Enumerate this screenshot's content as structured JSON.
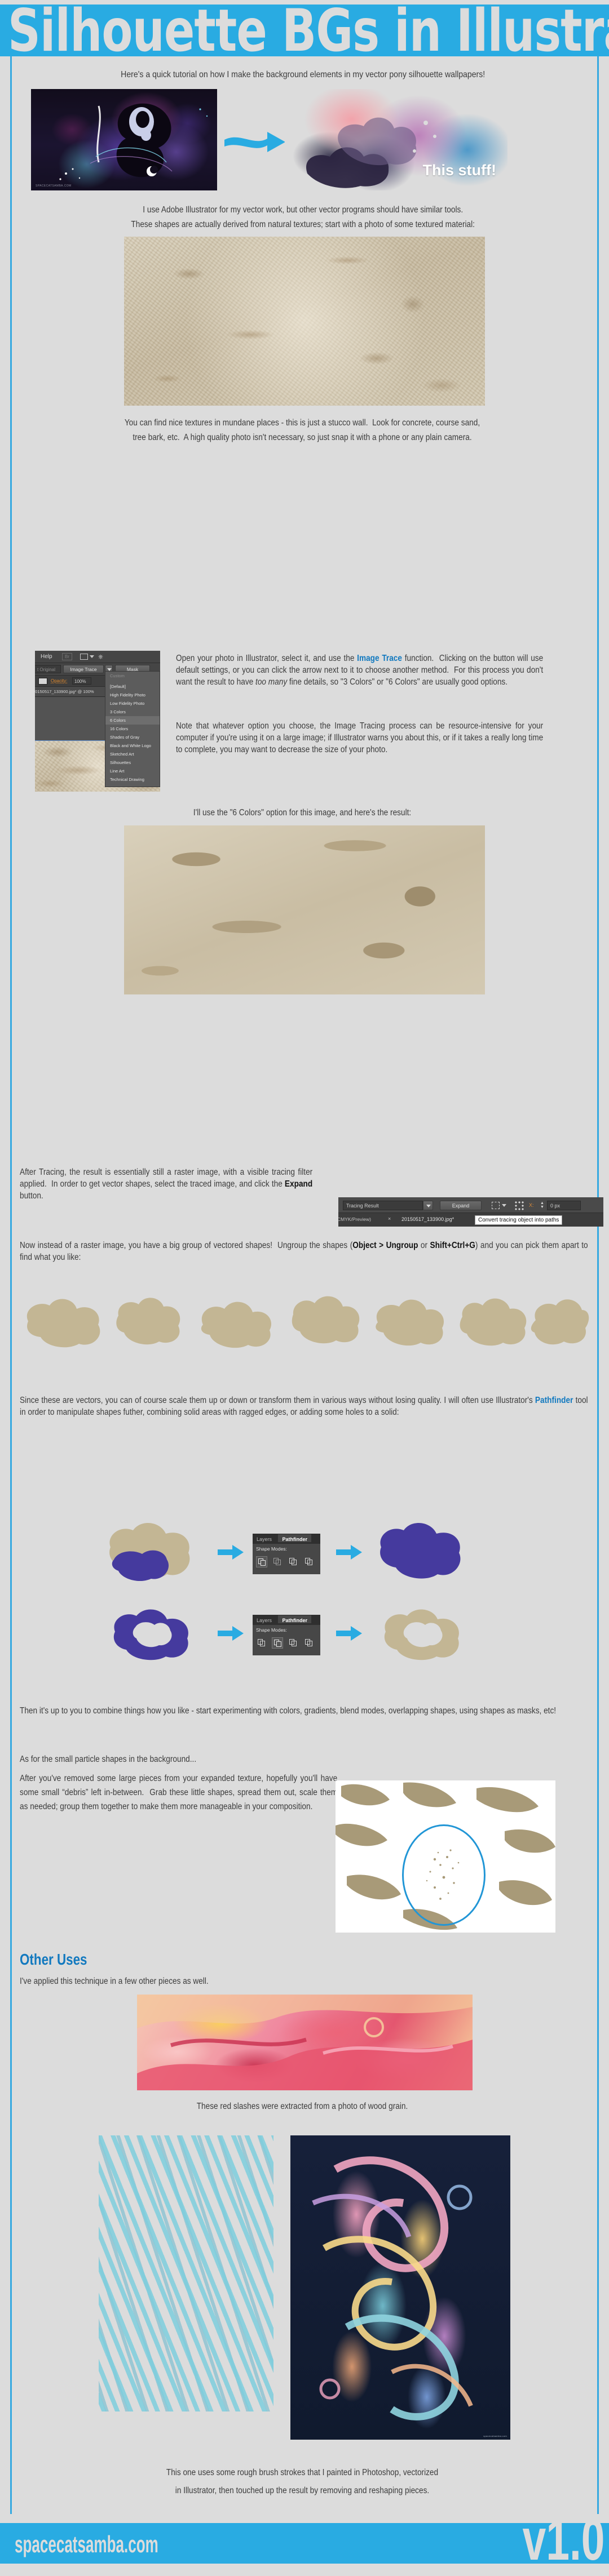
{
  "header": {
    "title": "Silhouette BGs in Illustrator",
    "accent_color": "#29abe2",
    "bg_color": "#dcdcdc"
  },
  "footer": {
    "site": "spacecatsamba.com",
    "version": "v1.0"
  },
  "intro": {
    "line": "Here's a quick tutorial on how I make the background elements in my vector pony silhouette wallpapers!",
    "callout_label": "This stuff!"
  },
  "section_tools": {
    "line1": "I use Adobe Illustrator for my vector work, but other vector programs should have similar tools.",
    "line2": "These shapes are actually derived from natural textures; start with a photo of some textured material:"
  },
  "section_texture": {
    "line1": "You can find nice textures in mundane places - this is just a stucco wall.  Look for concrete, course sand,",
    "line2": "tree bark, etc.  A high quality photo isn't necessary, so just snap it with a phone or any plain camera."
  },
  "section_trace": {
    "p1_a": "Open your photo in Illustrator, select it, and use the ",
    "p1_accent": "Image Trace",
    "p1_b": " function.  Clicking on the button will use default settings, or you can click the arrow next to it to choose another method.  For this process you don't want the result to have ",
    "p1_ital": "too many",
    "p1_c": " fine details, so \"3 Colors\" or \"6 Colors\" are usually good options.",
    "p2": "Note that whatever option you choose, the Image Tracing process can be resource-intensive for your computer if you're using it on a large image; if Illustrator warns you about this, or if it takes a really long time to complete, you may want to decrease the size of your photo.",
    "result_line": "I'll use the \"6 Colors\" option for this image, and here's the result:"
  },
  "illustrator_panel": {
    "menu_help": "Help",
    "btn_bridge": "Br",
    "btn_original": "t Original",
    "btn_image_trace": "Image Trace",
    "btn_mask": "Mask",
    "doc_title": "20150517_133900.jpg* @ 100%",
    "opacity_label": "Opacity:",
    "opacity_value": "100%",
    "dropdown_items": [
      "Custom",
      "[Default]",
      "High Fidelity Photo",
      "Low Fidelity Photo",
      "3 Colors",
      "6 Colors",
      "16 Colors",
      "Shades of Gray",
      "Black and White Logo",
      "Sketched Art",
      "Silhouettes",
      "Line Art",
      "Technical Drawing"
    ],
    "selected_item": "6 Colors",
    "dim_item": "Custom"
  },
  "section_expand": {
    "p1_a": "After Tracing, the result is essentially still a raster image, with a visible tracing filter applied.  In order to get vector shapes, select the traced image, and click the ",
    "p1_bold": "Expand",
    "p1_b": " button.",
    "toolbar": {
      "preset": "Tracing Result",
      "expand_btn": "Expand",
      "px_value": "0 px",
      "tab_left": "CMYK/Preview)",
      "tab_close": "×",
      "tab_doc": "20150517_133900.jpg*",
      "tooltip": "Convert tracing object into paths"
    }
  },
  "section_ungroup": {
    "a": "Now instead of a raster image, you have a big group of vectored shapes!  Ungroup the shapes (",
    "bold1": "Object > Ungroup",
    "b": " or ",
    "bold2": "Shift+Ctrl+G",
    "c": ") and you can pick them apart to find what you like:"
  },
  "section_pathfinder": {
    "a": "Since these are vectors, you can of course scale them up or down or transform them in various ways without losing quality. I will often use Illustrator's ",
    "accent": "Pathfinder",
    "b": " tool in order to manipulate shapes futher, combining solid areas with ragged edges, or adding some holes to a solid:",
    "panel": {
      "tab_layers": "Layers",
      "tab_pathfinder": "Pathfinder",
      "shape_modes_label": "Shape Modes:"
    }
  },
  "section_combine": {
    "p1": "Then it's up to you to combine things how you like - start experimenting with colors, gradients, blend modes, overlapping shapes, using shapes as masks, etc!",
    "p2_head": "As for the small particle shapes in the background...",
    "p2": "After you've removed some large pieces from your expanded texture, hopefully you'll have some small “debris” left in-between.  Grab these little shapes, spread them out, scale them as needed; group them together to make them more manageable in your composition."
  },
  "other_uses": {
    "heading": "Other Uses",
    "intro": "I've applied this technique in a few other pieces as well.",
    "caption_red": "These red slashes were extracted from a photo of wood grain.",
    "caption_bottom_line1": "This one uses some rough brush strokes that I painted in Photoshop, vectorized",
    "caption_bottom_line2": "in Illustrator, then touched up the result by removing and reshaping pieces."
  },
  "watermarks": {
    "wallpaper": "SPACECATSAMBA.COM",
    "poster": "spacecatsamba.com"
  },
  "colors": {
    "accent_blue": "#29abe2",
    "link_blue": "#1279bf",
    "page_bg": "#dcdcdc",
    "text": "#3c3c3c",
    "tan": "#cdc3ab",
    "purple": "#453a9e"
  }
}
